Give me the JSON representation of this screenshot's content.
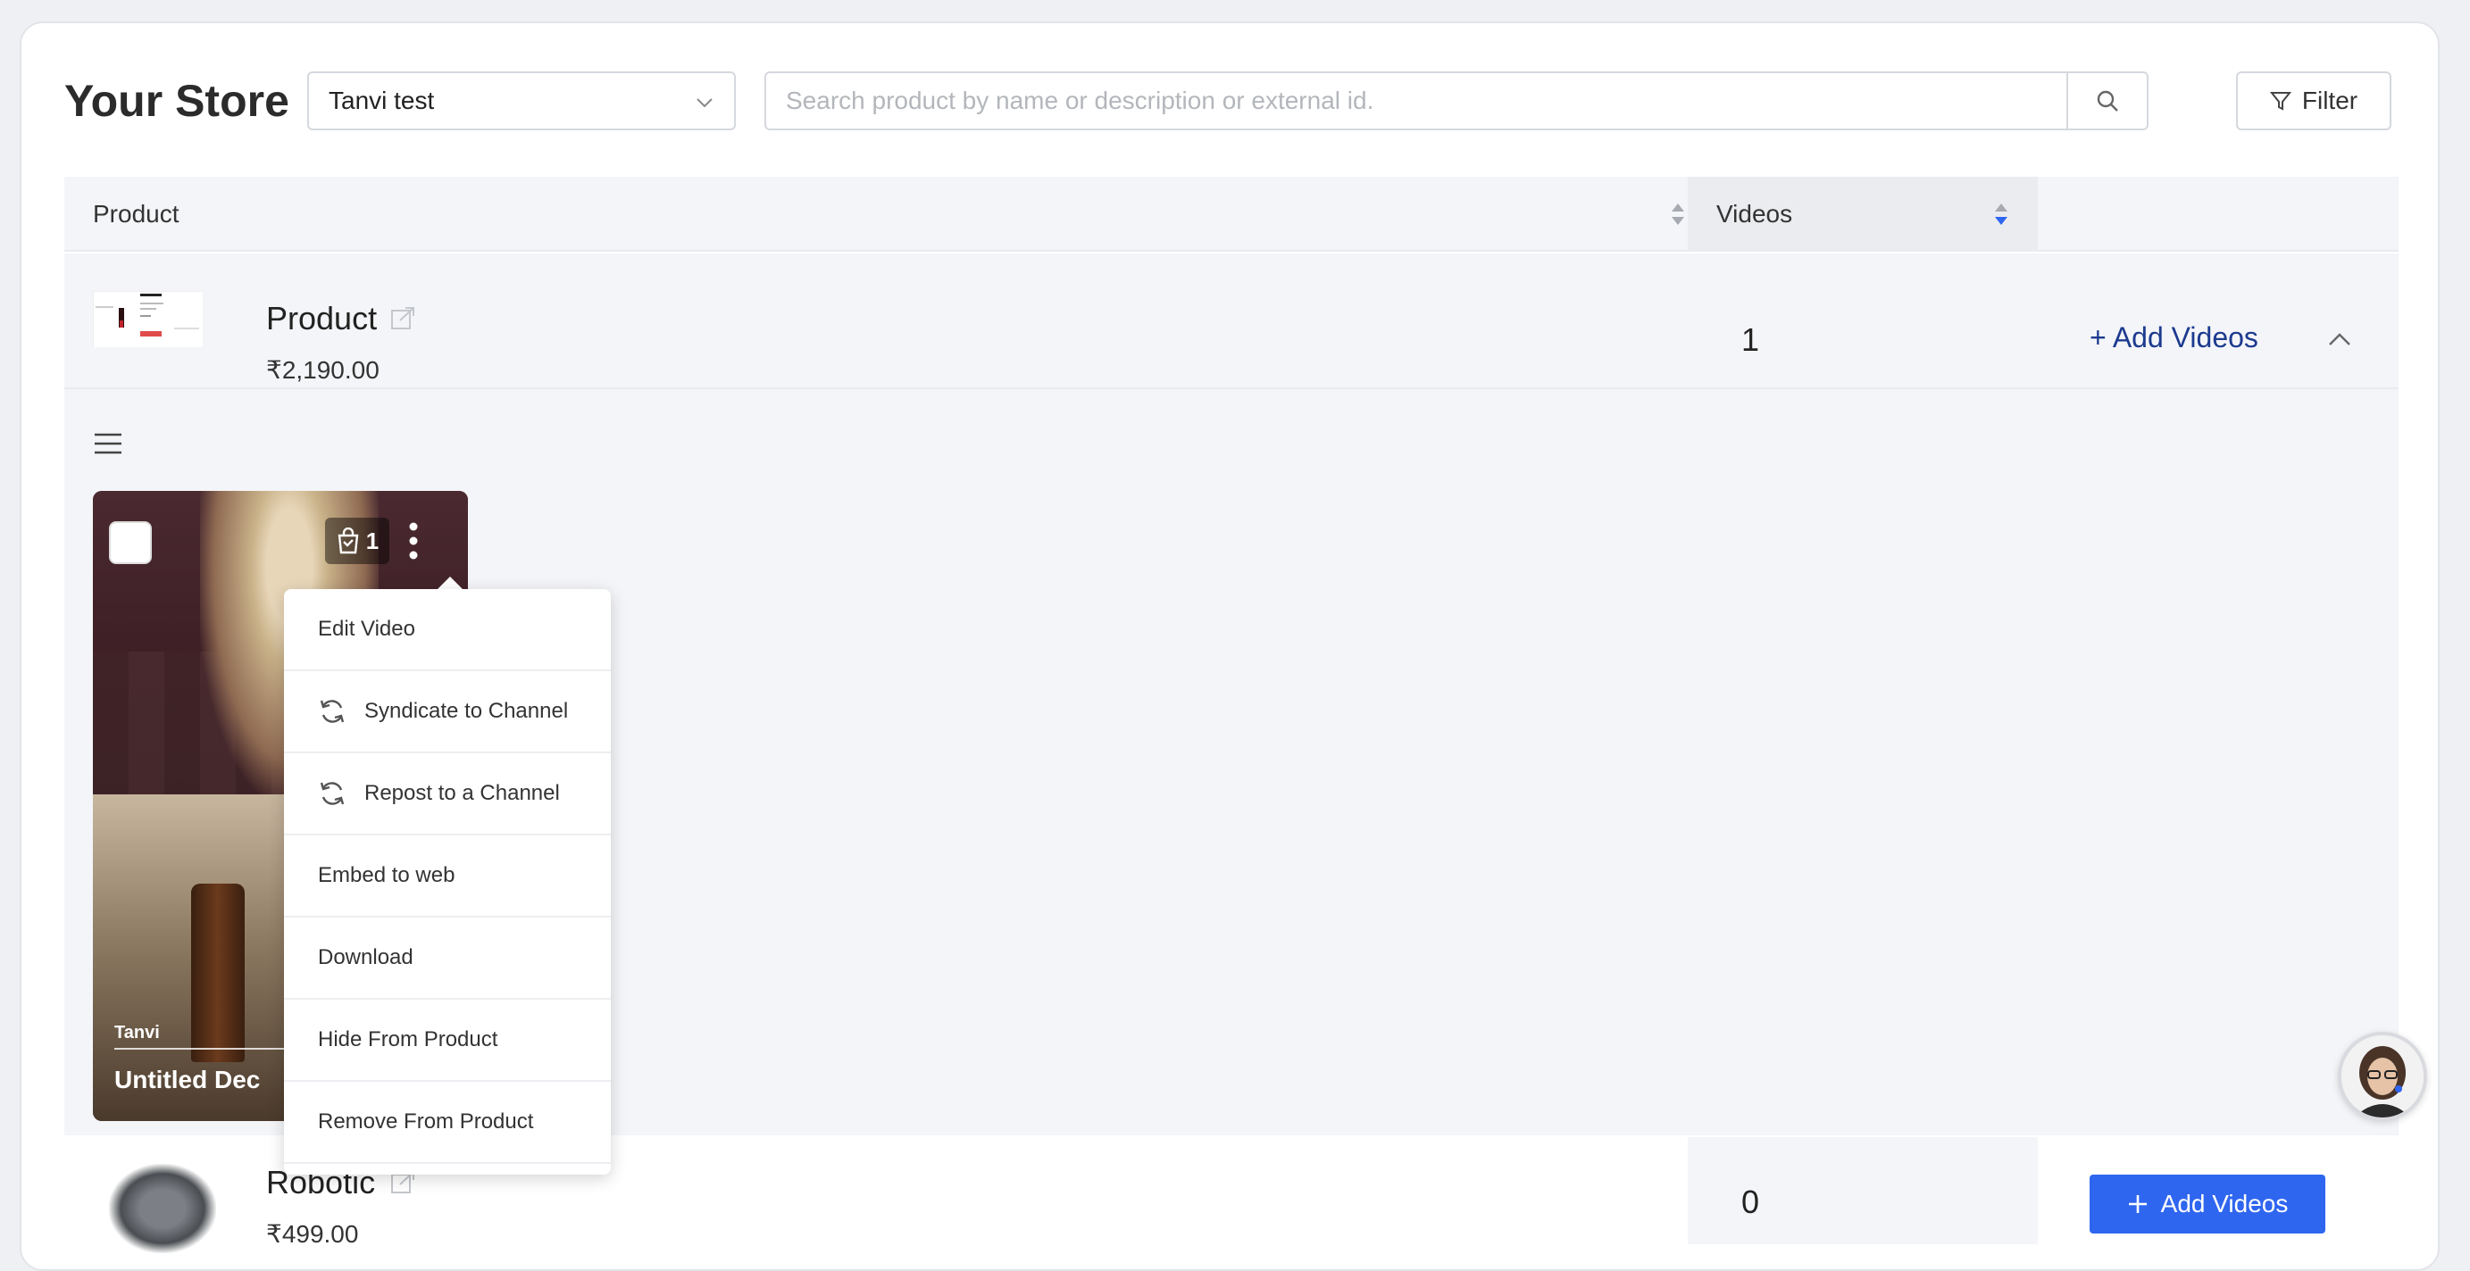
{
  "header": {
    "title": "Your Store",
    "store_select": {
      "value": "Tanvi test"
    },
    "search": {
      "placeholder": "Search product by name or description or external id.",
      "value": ""
    },
    "filter_label": "Filter"
  },
  "table": {
    "columns": [
      "Product",
      "Videos"
    ],
    "rows": [
      {
        "name": "Product",
        "price": "₹2,190.00",
        "videos_count": "1",
        "action_label": "+ Add Videos",
        "expanded": true,
        "videos": [
          {
            "author": "Tanvi",
            "title": "Untitled Dec",
            "tagged_products": "1"
          }
        ]
      },
      {
        "name": "Robotic",
        "price": "₹499.00",
        "videos_count": "0",
        "action_label": "Add Videos",
        "expanded": false
      }
    ]
  },
  "video_menu": {
    "items": [
      {
        "label": "Edit Video",
        "icon": ""
      },
      {
        "label": "Syndicate to Channel",
        "icon": "sync-icon"
      },
      {
        "label": "Repost to a Channel",
        "icon": "sync-icon"
      },
      {
        "label": "Embed to web",
        "icon": ""
      },
      {
        "label": "Download",
        "icon": ""
      },
      {
        "label": "Hide From Product",
        "icon": ""
      },
      {
        "label": "Remove From Product",
        "icon": ""
      }
    ]
  },
  "colors": {
    "primary": "#2f66f0",
    "link": "#1c3a8f",
    "table_bg": "#f4f5f8"
  }
}
